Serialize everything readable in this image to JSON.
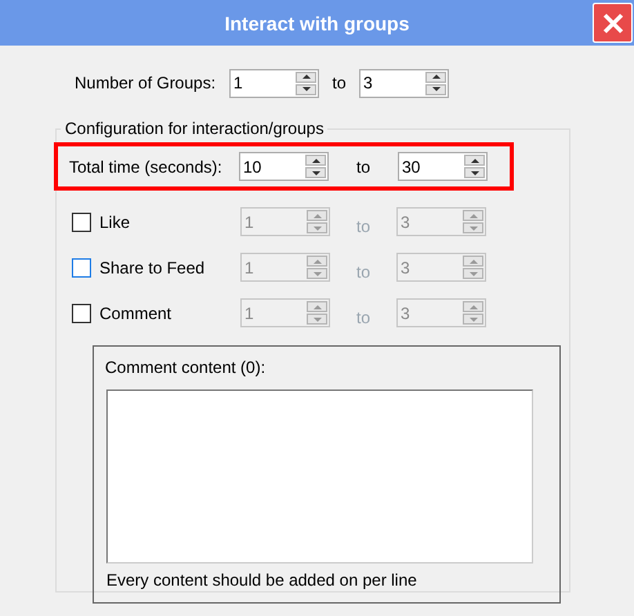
{
  "window": {
    "title": "Interact with groups"
  },
  "number_of_groups": {
    "label": "Number of Groups:",
    "from": "1",
    "to_label": "to",
    "to": "3"
  },
  "config": {
    "legend": "Configuration for interaction/groups",
    "total_time": {
      "label": "Total time (seconds):",
      "from": "10",
      "to_label": "to",
      "to": "30",
      "highlighted": true
    },
    "options": [
      {
        "label": "Like",
        "checked": false,
        "focused": false,
        "disabled": true,
        "from": "1",
        "to_label": "to",
        "to": "3"
      },
      {
        "label": "Share to Feed",
        "checked": false,
        "focused": true,
        "disabled": true,
        "from": "1",
        "to_label": "to",
        "to": "3"
      },
      {
        "label": "Comment",
        "checked": false,
        "focused": false,
        "disabled": true,
        "from": "1",
        "to_label": "to",
        "to": "3"
      }
    ],
    "comment_box": {
      "label": "Comment content (0):",
      "footer": "Every content should be added on per line"
    }
  }
}
